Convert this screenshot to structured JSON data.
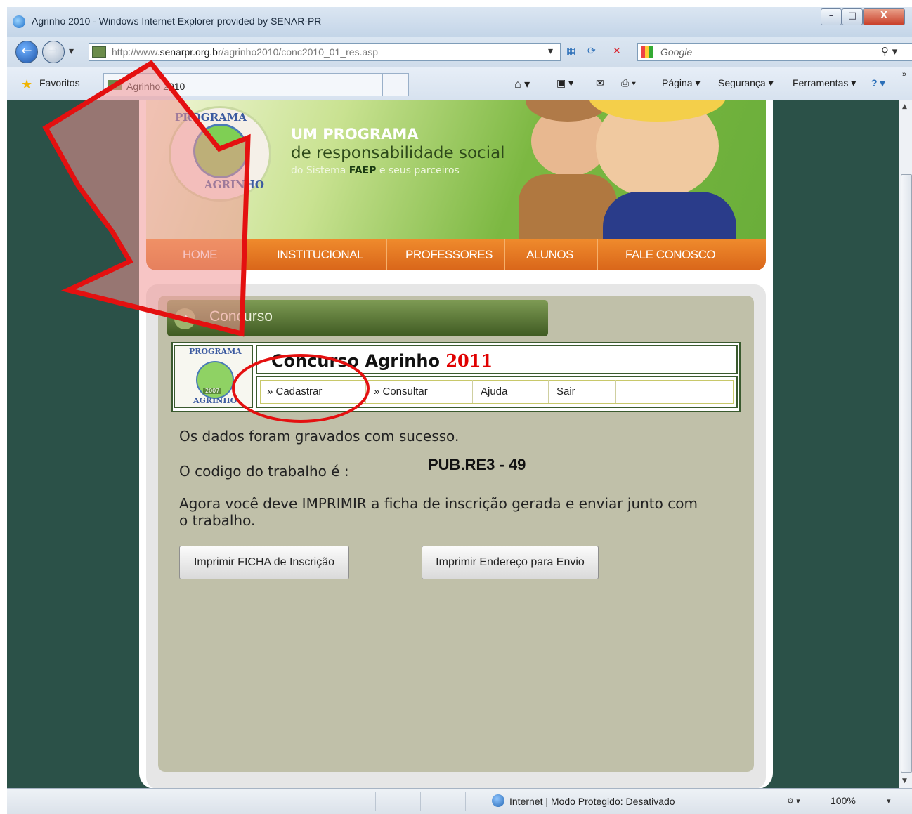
{
  "window": {
    "title": "Agrinho 2010 - Windows Internet Explorer provided by SENAR-PR",
    "minimize": "–",
    "maximize": "□",
    "close": "X"
  },
  "address": {
    "url_prefix": "http://www.",
    "url_host": "senarpr.org.br",
    "url_path": "/agrinho2010/conc2010_01_res.asp",
    "search_placeholder": "Google"
  },
  "favbar": {
    "favorites_label": "Favoritos",
    "tab_title": "Agrinho 2010",
    "cmd_pagina": "Página ▾",
    "cmd_seguranca": "Segurança ▾",
    "cmd_ferramentas": "Ferramentas ▾"
  },
  "header": {
    "logo_top": "PROGRAMA",
    "logo_bottom": "AGRINHO",
    "line1": "UM PROGRAMA",
    "line2": "de responsabilidade social",
    "line3_pre": "do Sistema ",
    "line3_brand": "FAEP",
    "line3_post": " e seus parceiros"
  },
  "menu": [
    "HOME",
    "INSTITUCIONAL",
    "PROFESSORES",
    "ALUNOS",
    "FALE CONOSCO"
  ],
  "section_title": "Concurso",
  "concurso": {
    "logo_top": "PROGRAMA",
    "logo_year": "2007",
    "logo_bottom": "AGRINHO",
    "title": "Concurso Agrinho",
    "year": "2011",
    "links": [
      "» Cadastrar",
      "» Consultar",
      "Ajuda",
      "Sair"
    ]
  },
  "messages": {
    "success": "Os dados foram gravados com sucesso.",
    "code_label": "O codigo do trabalho é :",
    "code_value": "PUB.RE3 - 49",
    "instruction_1": "Agora você deve IMPRIMIR a ficha de inscrição gerada e enviar junto com",
    "instruction_2": "o trabalho."
  },
  "buttons": {
    "print_form": "Imprimir FICHA de Inscrição",
    "print_address": "Imprimir Endereço para Envio"
  },
  "status": {
    "text": "Internet | Modo Protegido: Desativado",
    "zoom": "100%"
  },
  "colors": {
    "accent_orange": "#e07420",
    "header_green": "#7cb842",
    "page_bg": "#2b5148",
    "annotation_red": "#e41010"
  }
}
